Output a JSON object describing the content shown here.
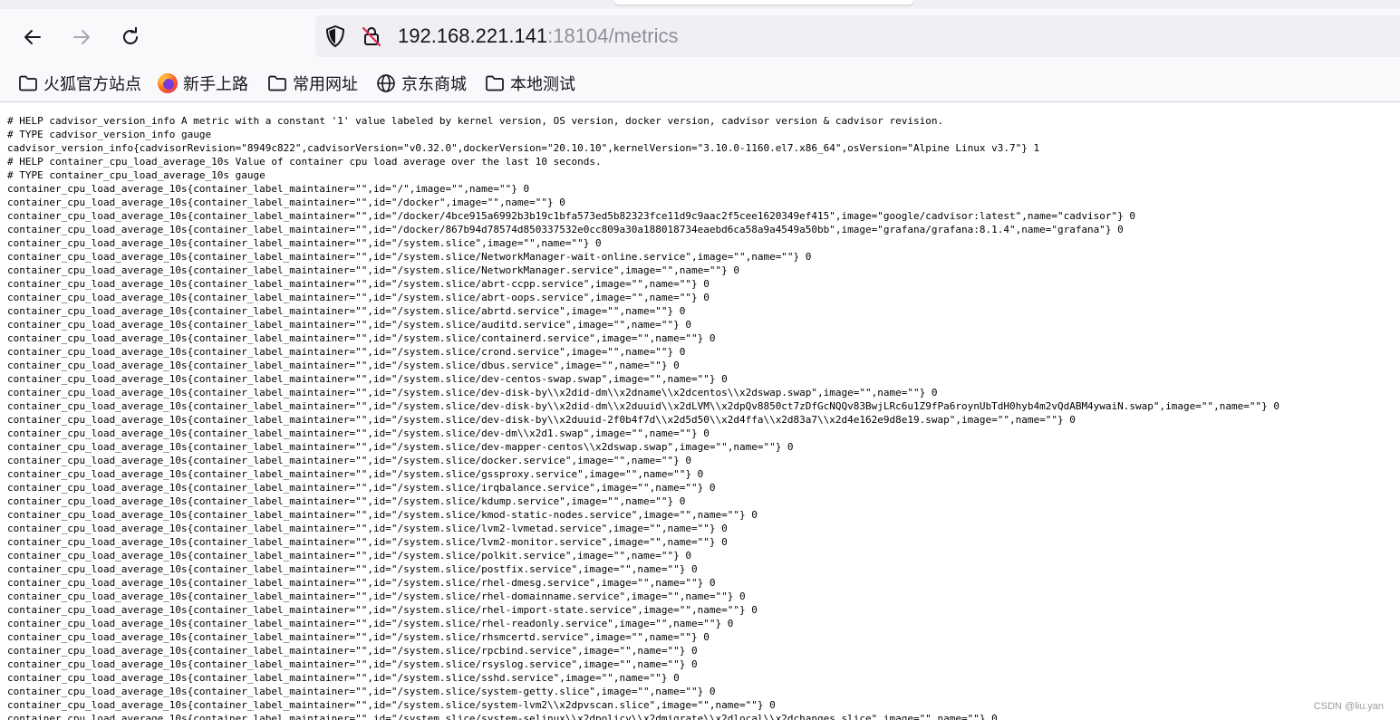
{
  "browser": {
    "url_host": "192.168.221.141",
    "url_rest": ":18104/metrics",
    "nav_icons": [
      "back-arrow-icon",
      "forward-arrow-icon",
      "reload-icon",
      "shield-icon",
      "insecure-lock-icon"
    ]
  },
  "bookmarks": [
    {
      "label": "火狐官方站点",
      "icon": "folder-icon"
    },
    {
      "label": "新手上路",
      "icon": "firefox-logo-icon"
    },
    {
      "label": "常用网址",
      "icon": "folder-icon"
    },
    {
      "label": "京东商城",
      "icon": "globe-icon"
    },
    {
      "label": "本地测试",
      "icon": "folder-icon"
    }
  ],
  "colors": {
    "chrome_bg": "#f9f9fb",
    "urlbar_bg": "#f0f0f4",
    "url_host": "#15141a",
    "url_rest": "#8f8f9d",
    "text": "#000000"
  },
  "metrics_lines": [
    "# HELP cadvisor_version_info A metric with a constant '1' value labeled by kernel version, OS version, docker version, cadvisor version & cadvisor revision.",
    "# TYPE cadvisor_version_info gauge",
    "cadvisor_version_info{cadvisorRevision=\"8949c822\",cadvisorVersion=\"v0.32.0\",dockerVersion=\"20.10.10\",kernelVersion=\"3.10.0-1160.el7.x86_64\",osVersion=\"Alpine Linux v3.7\"} 1",
    "# HELP container_cpu_load_average_10s Value of container cpu load average over the last 10 seconds.",
    "# TYPE container_cpu_load_average_10s gauge",
    "container_cpu_load_average_10s{container_label_maintainer=\"\",id=\"/\",image=\"\",name=\"\"} 0",
    "container_cpu_load_average_10s{container_label_maintainer=\"\",id=\"/docker\",image=\"\",name=\"\"} 0",
    "container_cpu_load_average_10s{container_label_maintainer=\"\",id=\"/docker/4bce915a6992b3b19c1bfa573ed5b82323fce11d9c9aac2f5cee1620349ef415\",image=\"google/cadvisor:latest\",name=\"cadvisor\"} 0",
    "container_cpu_load_average_10s{container_label_maintainer=\"\",id=\"/docker/867b94d78574d850337532e0cc809a30a188018734eaebd6ca58a9a4549a50bb\",image=\"grafana/grafana:8.1.4\",name=\"grafana\"} 0",
    "container_cpu_load_average_10s{container_label_maintainer=\"\",id=\"/system.slice\",image=\"\",name=\"\"} 0",
    "container_cpu_load_average_10s{container_label_maintainer=\"\",id=\"/system.slice/NetworkManager-wait-online.service\",image=\"\",name=\"\"} 0",
    "container_cpu_load_average_10s{container_label_maintainer=\"\",id=\"/system.slice/NetworkManager.service\",image=\"\",name=\"\"} 0",
    "container_cpu_load_average_10s{container_label_maintainer=\"\",id=\"/system.slice/abrt-ccpp.service\",image=\"\",name=\"\"} 0",
    "container_cpu_load_average_10s{container_label_maintainer=\"\",id=\"/system.slice/abrt-oops.service\",image=\"\",name=\"\"} 0",
    "container_cpu_load_average_10s{container_label_maintainer=\"\",id=\"/system.slice/abrtd.service\",image=\"\",name=\"\"} 0",
    "container_cpu_load_average_10s{container_label_maintainer=\"\",id=\"/system.slice/auditd.service\",image=\"\",name=\"\"} 0",
    "container_cpu_load_average_10s{container_label_maintainer=\"\",id=\"/system.slice/containerd.service\",image=\"\",name=\"\"} 0",
    "container_cpu_load_average_10s{container_label_maintainer=\"\",id=\"/system.slice/crond.service\",image=\"\",name=\"\"} 0",
    "container_cpu_load_average_10s{container_label_maintainer=\"\",id=\"/system.slice/dbus.service\",image=\"\",name=\"\"} 0",
    "container_cpu_load_average_10s{container_label_maintainer=\"\",id=\"/system.slice/dev-centos-swap.swap\",image=\"\",name=\"\"} 0",
    "container_cpu_load_average_10s{container_label_maintainer=\"\",id=\"/system.slice/dev-disk-by\\\\x2did-dm\\\\x2dname\\\\x2dcentos\\\\x2dswap.swap\",image=\"\",name=\"\"} 0",
    "container_cpu_load_average_10s{container_label_maintainer=\"\",id=\"/system.slice/dev-disk-by\\\\x2did-dm\\\\x2duuid\\\\x2dLVM\\\\x2dpQv8850ct7zDfGcNQQv83BwjLRc6u1Z9fPa6roynUbTdH0hyb4m2vQdABM4ywaiN.swap\",image=\"\",name=\"\"} 0",
    "container_cpu_load_average_10s{container_label_maintainer=\"\",id=\"/system.slice/dev-disk-by\\\\x2duuid-2f0b4f7d\\\\x2d5d50\\\\x2d4ffa\\\\x2d83a7\\\\x2d4e162e9d8e19.swap\",image=\"\",name=\"\"} 0",
    "container_cpu_load_average_10s{container_label_maintainer=\"\",id=\"/system.slice/dev-dm\\\\x2d1.swap\",image=\"\",name=\"\"} 0",
    "container_cpu_load_average_10s{container_label_maintainer=\"\",id=\"/system.slice/dev-mapper-centos\\\\x2dswap.swap\",image=\"\",name=\"\"} 0",
    "container_cpu_load_average_10s{container_label_maintainer=\"\",id=\"/system.slice/docker.service\",image=\"\",name=\"\"} 0",
    "container_cpu_load_average_10s{container_label_maintainer=\"\",id=\"/system.slice/gssproxy.service\",image=\"\",name=\"\"} 0",
    "container_cpu_load_average_10s{container_label_maintainer=\"\",id=\"/system.slice/irqbalance.service\",image=\"\",name=\"\"} 0",
    "container_cpu_load_average_10s{container_label_maintainer=\"\",id=\"/system.slice/kdump.service\",image=\"\",name=\"\"} 0",
    "container_cpu_load_average_10s{container_label_maintainer=\"\",id=\"/system.slice/kmod-static-nodes.service\",image=\"\",name=\"\"} 0",
    "container_cpu_load_average_10s{container_label_maintainer=\"\",id=\"/system.slice/lvm2-lvmetad.service\",image=\"\",name=\"\"} 0",
    "container_cpu_load_average_10s{container_label_maintainer=\"\",id=\"/system.slice/lvm2-monitor.service\",image=\"\",name=\"\"} 0",
    "container_cpu_load_average_10s{container_label_maintainer=\"\",id=\"/system.slice/polkit.service\",image=\"\",name=\"\"} 0",
    "container_cpu_load_average_10s{container_label_maintainer=\"\",id=\"/system.slice/postfix.service\",image=\"\",name=\"\"} 0",
    "container_cpu_load_average_10s{container_label_maintainer=\"\",id=\"/system.slice/rhel-dmesg.service\",image=\"\",name=\"\"} 0",
    "container_cpu_load_average_10s{container_label_maintainer=\"\",id=\"/system.slice/rhel-domainname.service\",image=\"\",name=\"\"} 0",
    "container_cpu_load_average_10s{container_label_maintainer=\"\",id=\"/system.slice/rhel-import-state.service\",image=\"\",name=\"\"} 0",
    "container_cpu_load_average_10s{container_label_maintainer=\"\",id=\"/system.slice/rhel-readonly.service\",image=\"\",name=\"\"} 0",
    "container_cpu_load_average_10s{container_label_maintainer=\"\",id=\"/system.slice/rhsmcertd.service\",image=\"\",name=\"\"} 0",
    "container_cpu_load_average_10s{container_label_maintainer=\"\",id=\"/system.slice/rpcbind.service\",image=\"\",name=\"\"} 0",
    "container_cpu_load_average_10s{container_label_maintainer=\"\",id=\"/system.slice/rsyslog.service\",image=\"\",name=\"\"} 0",
    "container_cpu_load_average_10s{container_label_maintainer=\"\",id=\"/system.slice/sshd.service\",image=\"\",name=\"\"} 0",
    "container_cpu_load_average_10s{container_label_maintainer=\"\",id=\"/system.slice/system-getty.slice\",image=\"\",name=\"\"} 0",
    "container_cpu_load_average_10s{container_label_maintainer=\"\",id=\"/system.slice/system-lvm2\\\\x2dpvscan.slice\",image=\"\",name=\"\"} 0",
    "container_cpu_load_average_10s{container_label_maintainer=\"\",id=\"/system.slice/system-selinux\\\\x2dpolicy\\\\x2dmigrate\\\\x2dlocal\\\\x2dchanges.slice\",image=\"\",name=\"\"} 0"
  ],
  "watermark": "CSDN @liu.yan"
}
